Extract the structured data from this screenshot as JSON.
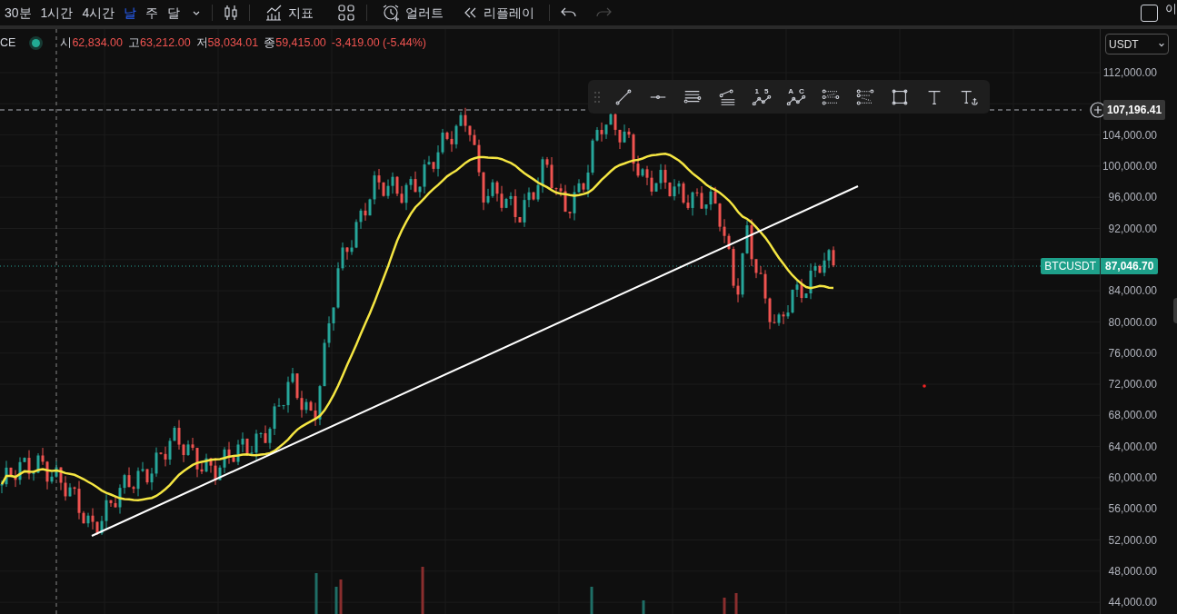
{
  "toolbar": {
    "intervals": [
      {
        "label": "30분",
        "selected": false
      },
      {
        "label": "1시간",
        "selected": false
      },
      {
        "label": "4시간",
        "selected": false
      },
      {
        "label": "날",
        "selected": true
      },
      {
        "label": "주",
        "selected": false
      },
      {
        "label": "달",
        "selected": false
      }
    ],
    "indicators": "지표",
    "alert": "얼러트",
    "replay": "리플레이",
    "redo_disabled": true,
    "checkbox_checked": false,
    "right_label": "이"
  },
  "wave_tools": [
    {
      "labels": [
        "1",
        "5"
      ]
    },
    {
      "labels": [
        "A",
        "C"
      ]
    }
  ],
  "legend": {
    "symbol": "CE",
    "open_label": "시",
    "open": "62,834.00",
    "high_label": "고",
    "high": "63,212.00",
    "low_label": "저",
    "low": "58,034.01",
    "close_label": "종",
    "close": "59,415.00",
    "change": "-3,419.00 (-5.44%)"
  },
  "currency": "USDT",
  "price_axis": {
    "upper_ticks": [
      "112,000.00"
    ],
    "middle_ticks": [
      "104,000.00",
      "100,000.00",
      "96,000.00",
      "92,000.00"
    ],
    "lower_ticks": [
      "84,000.00",
      "80,000.00",
      "76,000.00",
      "72,000.00",
      "68,000.00",
      "64,000.00",
      "60,000.00",
      "56,000.00",
      "52,000.00",
      "48,000.00",
      "44,000.00"
    ]
  },
  "crosshair_price": "107,196.41",
  "last_price": {
    "symbol": "BTCUSDT",
    "price": "87,046.70"
  }
}
